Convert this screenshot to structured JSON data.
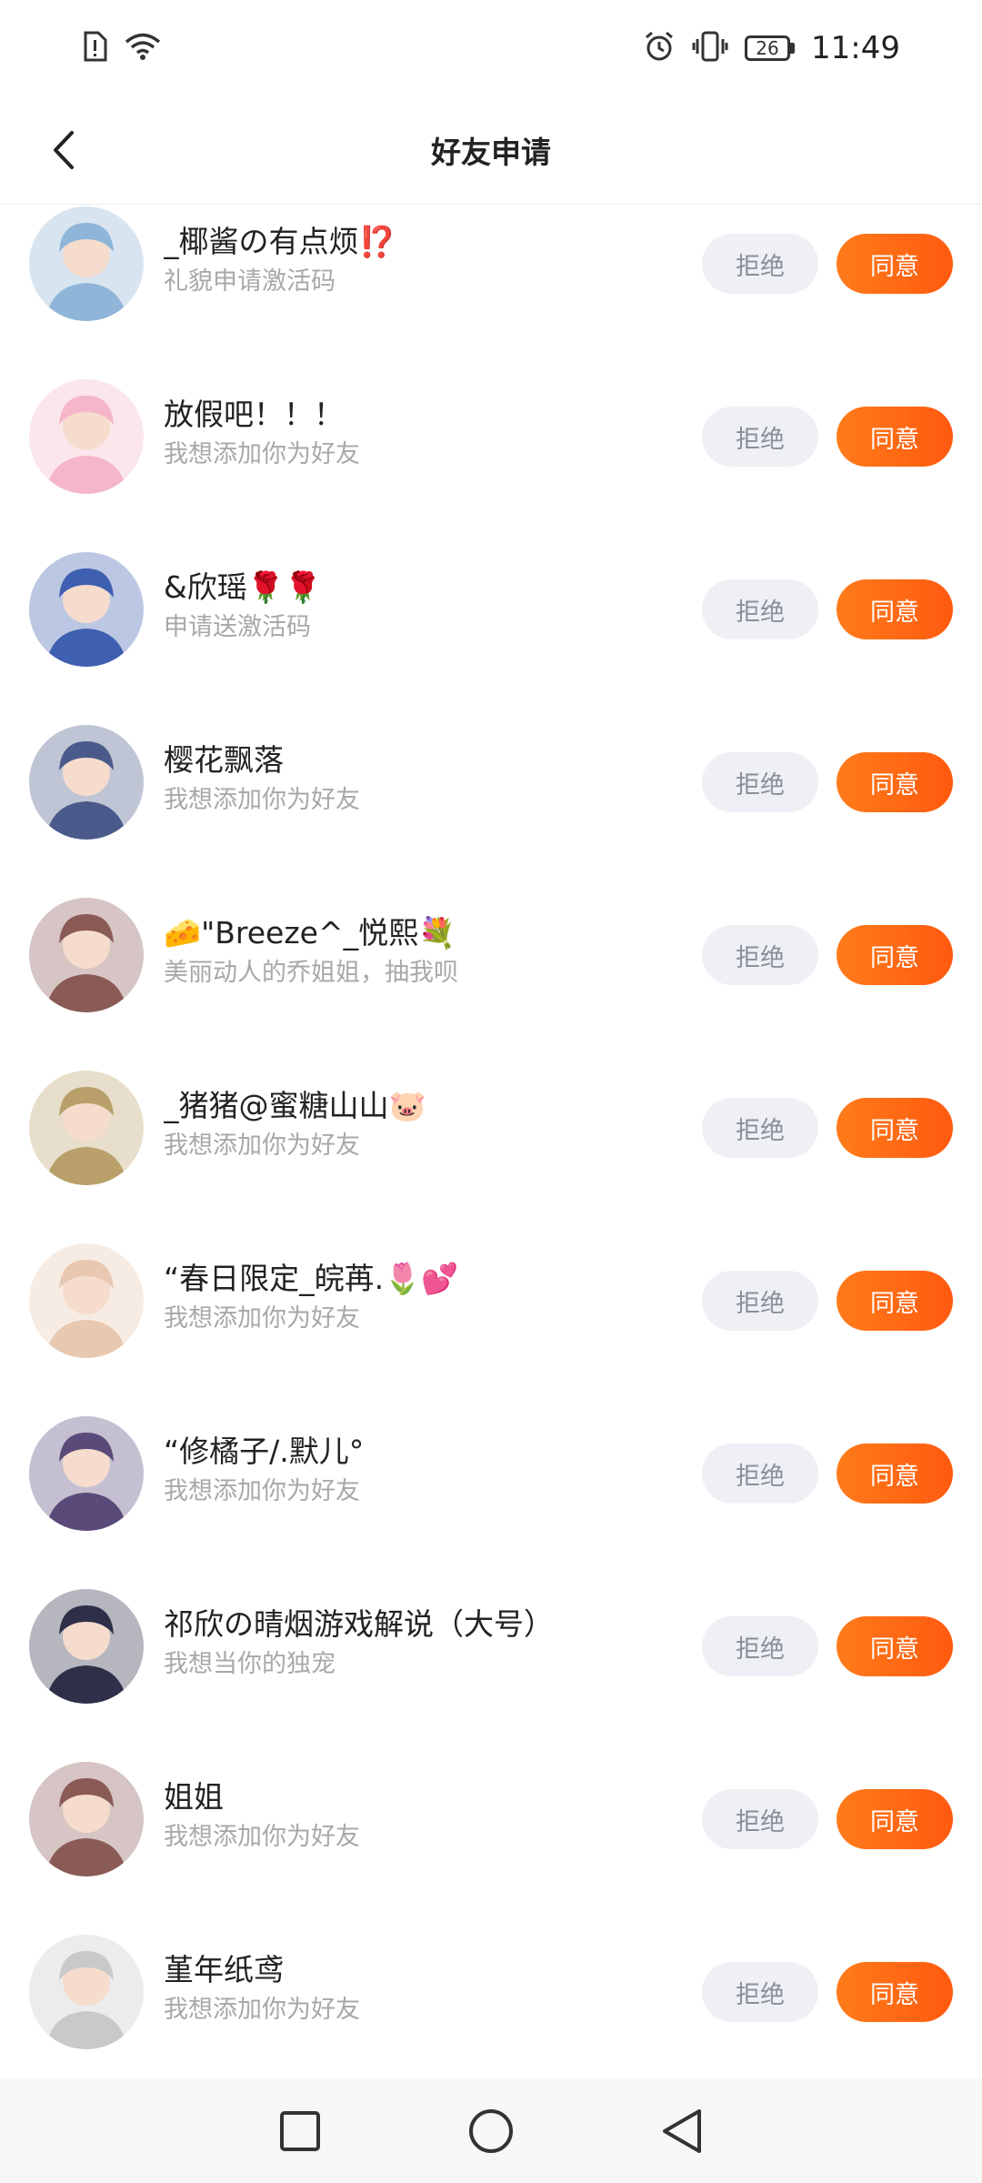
{
  "status_bar": {
    "battery_level": "26",
    "time": "11:49",
    "icons": [
      "sim-alert-icon",
      "wifi-icon",
      "alarm-icon",
      "vibrate-icon",
      "battery-icon"
    ]
  },
  "header": {
    "title": "好友申请",
    "back_icon": "chevron-left-icon"
  },
  "buttons": {
    "reject_label": "拒绝",
    "accept_label": "同意"
  },
  "requests": [
    {
      "name": "_椰酱の有点烦⁉️",
      "message": "礼貌申请激活码",
      "avatar_color": "#8fb5d8"
    },
    {
      "name": "放假吧！！！",
      "message": "我想添加你为好友",
      "avatar_color": "#f4b6c8"
    },
    {
      "name": "&欣瑶🌹🌹",
      "message": "申请送激活码",
      "avatar_color": "#3f5fb0"
    },
    {
      "name": "樱花飘落",
      "message": "我想添加你为好友",
      "avatar_color": "#4a5a8a"
    },
    {
      "name": "🧀\"Breeze^_悦熙💐",
      "message": "美丽动人的乔姐姐，抽我呗",
      "avatar_color": "#8a5a55"
    },
    {
      "name": "_猪猪@蜜糖山山🐷",
      "message": "我想添加你为好友",
      "avatar_color": "#b9a06a"
    },
    {
      "name": "“春日限定_皖苒.🌷💕",
      "message": "我想添加你为好友",
      "avatar_color": "#e8c8b0"
    },
    {
      "name": "“修橘子/.默儿°",
      "message": "我想添加你为好友",
      "avatar_color": "#5a4a7a"
    },
    {
      "name": "祁欣の晴烟游戏解说（大号）",
      "message": "我想当你的独宠",
      "avatar_color": "#2e2f48"
    },
    {
      "name": "姐姐",
      "message": "我想添加你为好友",
      "avatar_color": "#8a5a55"
    },
    {
      "name": "堇年纸鸢",
      "message": "我想添加你为好友",
      "avatar_color": "#c9c9c9"
    }
  ],
  "nav_bar": {
    "icons": [
      "recents-square-icon",
      "home-circle-icon",
      "back-triangle-icon"
    ]
  },
  "colors": {
    "accent": "#ff6a13",
    "reject_bg": "#eef0f5",
    "subtext": "#a8a8a8"
  }
}
